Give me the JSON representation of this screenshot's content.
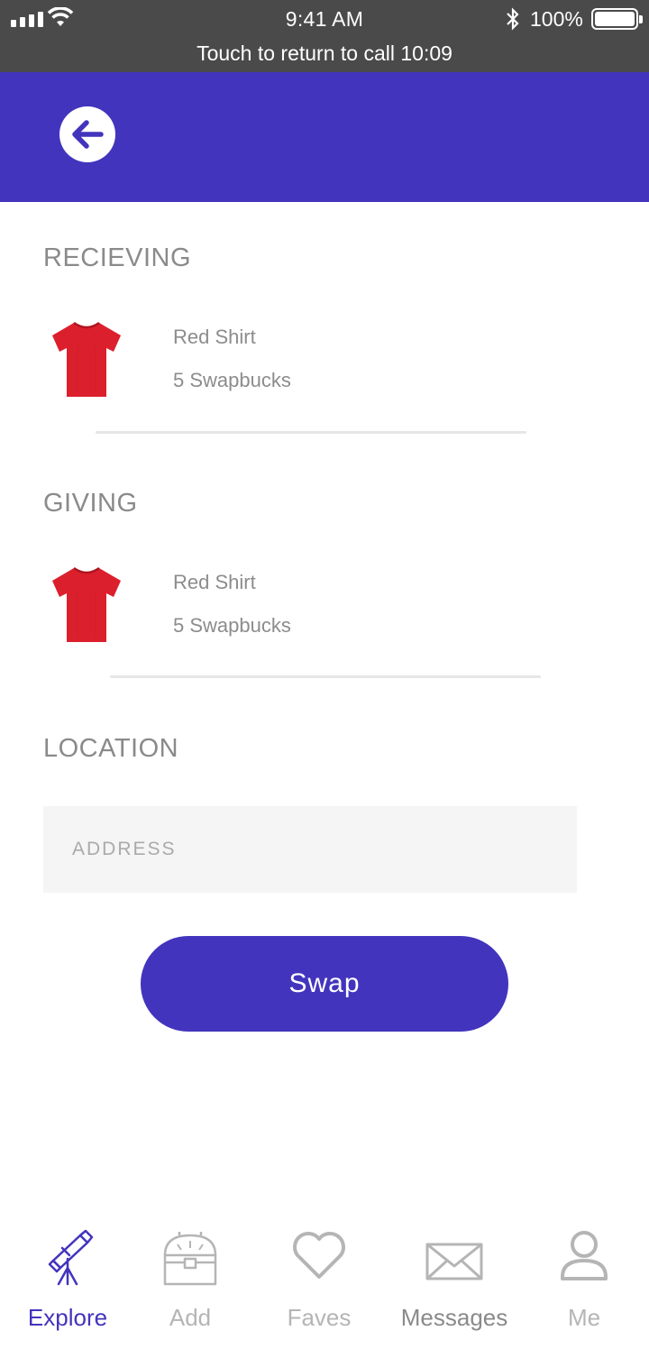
{
  "status_bar": {
    "time": "9:41 AM",
    "battery": "100%",
    "call_banner": "Touch to return to call 10:09"
  },
  "header": {
    "back_icon": "arrow-left-icon",
    "accent_color": "#4334bd"
  },
  "receiving": {
    "title": "RECIEVING",
    "item_name": "Red Shirt",
    "item_price": "5 Swapbucks",
    "item_icon": "red-shirt-image"
  },
  "giving": {
    "title": "GIVING",
    "item_name": "Red Shirt",
    "item_price": "5 Swapbucks",
    "item_icon": "red-shirt-image"
  },
  "location": {
    "title": "LOCATION",
    "address_placeholder": "ADDRESS",
    "address_value": ""
  },
  "swap_button": {
    "label": "Swap"
  },
  "tab_bar": {
    "tabs": [
      {
        "label": "Explore",
        "icon": "telescope-icon",
        "active": true
      },
      {
        "label": "Add",
        "icon": "treasure-chest-icon",
        "active": false
      },
      {
        "label": "Faves",
        "icon": "heart-icon",
        "active": false
      },
      {
        "label": "Messages",
        "icon": "envelope-icon",
        "active": false
      },
      {
        "label": "Me",
        "icon": "person-icon",
        "active": false
      }
    ]
  }
}
